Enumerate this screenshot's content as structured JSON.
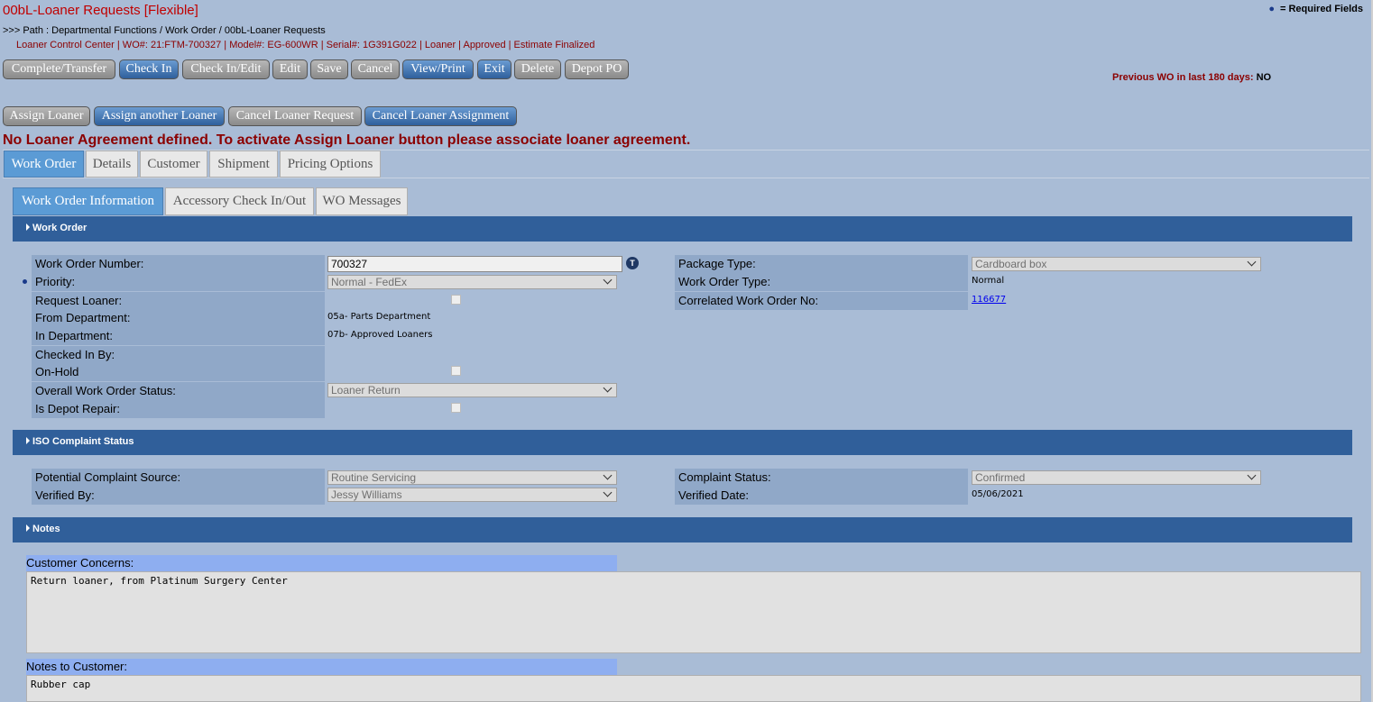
{
  "header": {
    "title": "00bL-Loaner Requests [Flexible]",
    "required_legend": "= Required Fields",
    "path": ">>> Path : Departmental Functions / Work Order / 00bL-Loaner Requests",
    "context": "Loaner Control Center | WO#: 21:FTM-700327 | Model#: EG-600WR | Serial#: 1G391G022 | Loaner | Approved | Estimate Finalized"
  },
  "toolbar": {
    "complete_transfer": "Complete/Transfer",
    "check_in": "Check In",
    "check_in_edit": "Check In/Edit",
    "edit": "Edit",
    "save": "Save",
    "cancel": "Cancel",
    "view_print": "View/Print",
    "exit": "Exit",
    "delete": "Delete",
    "depot_po": "Depot PO"
  },
  "previous_wo": {
    "label": "Previous WO in last 180 days:",
    "value": "NO"
  },
  "loaner_toolbar": {
    "assign_loaner": "Assign Loaner",
    "assign_another_loaner": "Assign another Loaner",
    "cancel_loaner_request": "Cancel Loaner Request",
    "cancel_loaner_assignment": "Cancel Loaner Assignment"
  },
  "error_message": "No Loaner Agreement defined. To activate Assign Loaner button please associate loaner agreement.",
  "main_tabs": [
    "Work Order",
    "Details",
    "Customer",
    "Shipment",
    "Pricing Options"
  ],
  "sub_tabs": [
    "Work Order Information",
    "Accessory Check In/Out",
    "WO Messages"
  ],
  "sections": {
    "work_order": "Work Order",
    "iso": "ISO Complaint Status",
    "notes": "Notes"
  },
  "work_order": {
    "wo_number_label": "Work Order Number:",
    "wo_number_value": "700327",
    "tooltip_icon": "T",
    "priority_label": "Priority:",
    "priority_value": "Normal - FedEx",
    "request_loaner_label": "Request Loaner:",
    "from_dept_label": "From Department:",
    "from_dept_value": "05a- Parts Department",
    "in_dept_label": "In Department:",
    "in_dept_value": "07b- Approved Loaners",
    "checked_in_by_label": "Checked In By:",
    "on_hold_label": "On-Hold",
    "overall_status_label": "Overall Work Order Status:",
    "overall_status_value": "Loaner Return",
    "depot_repair_label": "Is Depot Repair:",
    "package_type_label": "Package Type:",
    "package_type_value": "Cardboard box",
    "wo_type_label": "Work Order Type:",
    "wo_type_value": "Normal",
    "correlated_label": "Correlated Work Order No:",
    "correlated_value": "116677"
  },
  "iso": {
    "source_label": "Potential Complaint Source:",
    "source_value": "Routine Servicing",
    "verified_by_label": "Verified By:",
    "verified_by_value": "Jessy Williams",
    "status_label": "Complaint Status:",
    "status_value": "Confirmed",
    "verified_date_label": "Verified Date:",
    "verified_date_value": "05/06/2021"
  },
  "notes": {
    "concerns_label": "Customer Concerns:",
    "concerns_value": "Return loaner, from Platinum Surgery Center",
    "to_customer_label": "Notes to Customer:",
    "to_customer_value": "Rubber cap"
  }
}
